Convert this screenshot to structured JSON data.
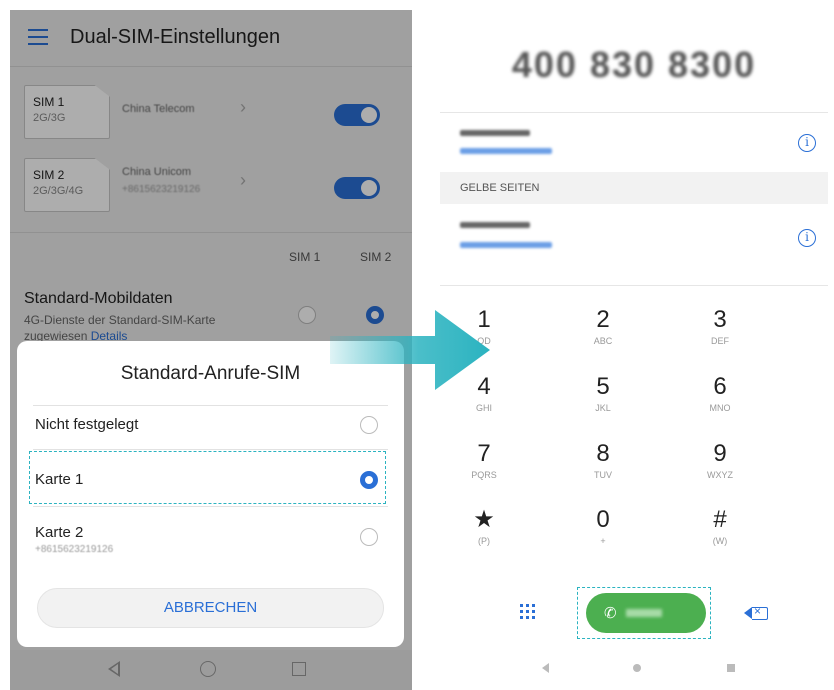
{
  "left": {
    "title": "Dual-SIM-Einstellungen",
    "sims": [
      {
        "name": "SIM 1",
        "type": "2G/3G",
        "carrier": "China Telecom",
        "number": "",
        "enabled": true
      },
      {
        "name": "SIM 2",
        "type": "2G/3G/4G",
        "carrier": "China Unicom",
        "number": "+8615623219126",
        "enabled": true
      }
    ],
    "columns": [
      "SIM 1",
      "SIM 2"
    ],
    "mobile_data": {
      "title": "Standard-Mobildaten",
      "subtitle": "4G-Dienste der Standard-SIM-Karte zugewiesen",
      "link": "Details",
      "selected": "SIM 2"
    },
    "dialog": {
      "title": "Standard-Anrufe-SIM",
      "options": [
        {
          "label": "Nicht festgelegt",
          "sub": "",
          "selected": false
        },
        {
          "label": "Karte 1",
          "sub": "",
          "selected": true
        },
        {
          "label": "Karte 2",
          "sub": "+8615623219126",
          "selected": false
        }
      ],
      "cancel": "ABBRECHEN"
    }
  },
  "right": {
    "number": "400 830 8300",
    "section": "GELBE SEITEN",
    "keys": [
      {
        "digit": "1",
        "letters": "QD"
      },
      {
        "digit": "2",
        "letters": "ABC"
      },
      {
        "digit": "3",
        "letters": "DEF"
      },
      {
        "digit": "4",
        "letters": "GHI"
      },
      {
        "digit": "5",
        "letters": "JKL"
      },
      {
        "digit": "6",
        "letters": "MNO"
      },
      {
        "digit": "7",
        "letters": "PQRS"
      },
      {
        "digit": "8",
        "letters": "TUV"
      },
      {
        "digit": "9",
        "letters": "WXYZ"
      },
      {
        "digit": "★",
        "letters": "(P)"
      },
      {
        "digit": "0",
        "letters": "+"
      },
      {
        "digit": "#",
        "letters": "(W)"
      }
    ]
  },
  "colors": {
    "accent": "#2a6fd6",
    "call": "#4caf50",
    "arrow": "#2bb3c0"
  }
}
